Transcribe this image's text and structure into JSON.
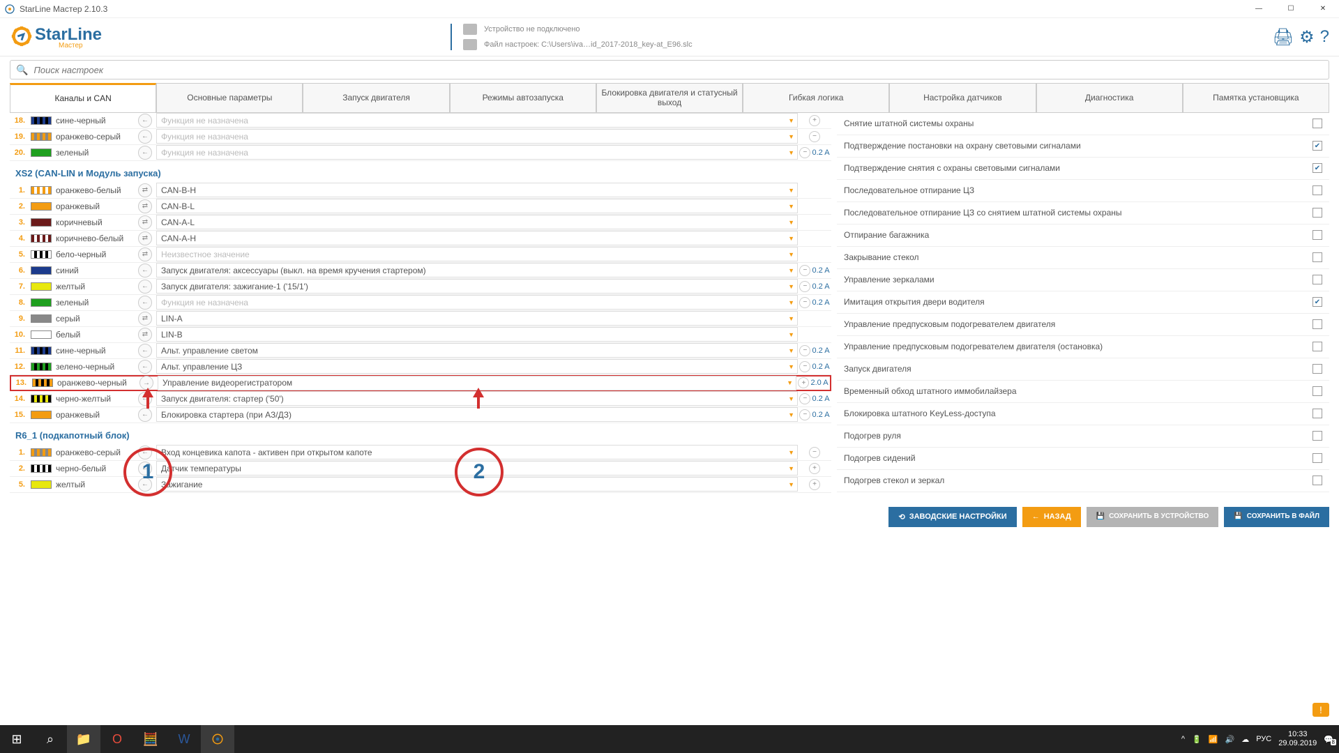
{
  "window": {
    "title": "StarLine Мастер 2.10.3"
  },
  "logo": {
    "brand": "StarLine",
    "sub": "Мастер"
  },
  "device": {
    "status": "Устройство не подключено",
    "file_label": "Файл настроек: C:\\Users\\iva…id_2017-2018_key-at_E96.slc"
  },
  "search": {
    "placeholder": "Поиск настроек"
  },
  "tabs": [
    "Каналы и CAN",
    "Основные параметры",
    "Запуск двигателя",
    "Режимы автозапуска",
    "Блокировка двигателя и статусный выход",
    "Гибкая логика",
    "Настройка датчиков",
    "Диагностика",
    "Памятка установщика"
  ],
  "tabs_active": 0,
  "channels_top": [
    {
      "n": "18.",
      "wire": "#1c3b8c/#000",
      "name": "сине-черный",
      "pol": "←",
      "func": "Функция не назначена",
      "gray": true,
      "amp": "",
      "pm": "+"
    },
    {
      "n": "19.",
      "wire": "#f39c12/#888",
      "name": "оранжево-серый",
      "pol": "←",
      "func": "Функция не назначена",
      "gray": true,
      "amp": "",
      "pm": "−"
    },
    {
      "n": "20.",
      "wire": "#1fa01f",
      "name": "зеленый",
      "pol": "←",
      "func": "Функция не назначена",
      "gray": true,
      "amp": "0.2 A",
      "pm": "−"
    }
  ],
  "section_xs2": "XS2 (CAN-LIN и Модуль запуска)",
  "channels_xs2": [
    {
      "n": "1.",
      "wire": "#f39c12/#fff",
      "name": "оранжево-белый",
      "pol": "⇄",
      "func": "CAN-B-H",
      "amp": ""
    },
    {
      "n": "2.",
      "wire": "#f39c12",
      "name": "оранжевый",
      "pol": "⇄",
      "func": "CAN-B-L",
      "amp": ""
    },
    {
      "n": "3.",
      "wire": "#6b1a1a",
      "name": "коричневый",
      "pol": "⇄",
      "func": "CAN-A-L",
      "amp": ""
    },
    {
      "n": "4.",
      "wire": "#6b1a1a/#fff",
      "name": "коричнево-белый",
      "pol": "⇄",
      "func": "CAN-A-H",
      "amp": ""
    },
    {
      "n": "5.",
      "wire": "#fff/#000",
      "name": "бело-черный",
      "pol": "⇄",
      "func": "Неизвестное значение",
      "gray": true,
      "amp": ""
    },
    {
      "n": "6.",
      "wire": "#1c3b8c",
      "name": "синий",
      "pol": "←",
      "func": "Запуск двигателя: аксессуары (выкл. на время кручения стартером)",
      "amp": "0.2 A",
      "pm": "−"
    },
    {
      "n": "7.",
      "wire": "#e8e80e",
      "name": "желтый",
      "pol": "←",
      "func": "Запуск двигателя: зажигание-1 ('15/1')",
      "amp": "0.2 A",
      "pm": "−"
    },
    {
      "n": "8.",
      "wire": "#1fa01f",
      "name": "зеленый",
      "pol": "←",
      "func": "Функция не назначена",
      "gray": true,
      "amp": "0.2 A",
      "pm": "−"
    },
    {
      "n": "9.",
      "wire": "#888",
      "name": "серый",
      "pol": "⇄",
      "func": "LIN-A",
      "amp": ""
    },
    {
      "n": "10.",
      "wire": "#fff",
      "name": "белый",
      "pol": "⇄",
      "func": "LIN-B",
      "amp": ""
    },
    {
      "n": "11.",
      "wire": "#1c3b8c/#000",
      "name": "сине-черный",
      "pol": "←",
      "func": "Альт. управление светом",
      "amp": "0.2 A",
      "pm": "−"
    },
    {
      "n": "12.",
      "wire": "#1fa01f/#000",
      "name": "зелено-черный",
      "pol": "←",
      "func": "Альт. управление ЦЗ",
      "amp": "0.2 A",
      "pm": "−"
    },
    {
      "n": "13.",
      "wire": "#f39c12/#000",
      "name": "оранжево-черный",
      "pol": "→",
      "func": "Управление видеорегистратором",
      "amp": "2.0 A",
      "pm": "+",
      "hl": true
    },
    {
      "n": "14.",
      "wire": "#000/#e8e80e",
      "name": "черно-желтый",
      "pol": "←",
      "func": "Запуск двигателя: стартер ('50')",
      "amp": "0.2 A",
      "pm": "−"
    },
    {
      "n": "15.",
      "wire": "#f39c12",
      "name": "оранжевый",
      "pol": "←",
      "func": "Блокировка стартера (при АЗ/ДЗ)",
      "amp": "0.2 A",
      "pm": "−"
    }
  ],
  "section_r6": "R6_1 (подкапотный блок)",
  "channels_r6": [
    {
      "n": "1.",
      "wire": "#f39c12/#888",
      "name": "оранжево-серый",
      "pol": "←",
      "func": "Вход концевика капота - активен при открытом капоте",
      "amp": "",
      "pm": "−"
    },
    {
      "n": "2.",
      "wire": "#000/#fff",
      "name": "черно-белый",
      "pol": "←",
      "func": "Датчик температуры",
      "amp": "",
      "pm": "+"
    },
    {
      "n": "5.",
      "wire": "#e8e80e",
      "name": "желтый",
      "pol": "←",
      "func": "Зажигание",
      "amp": "",
      "pm": "+"
    }
  ],
  "options": [
    {
      "label": "Снятие штатной системы охраны",
      "chk": false
    },
    {
      "label": "Подтверждение постановки на охрану световыми сигналами",
      "chk": true
    },
    {
      "label": "Подтверждение снятия с охраны световыми сигналами",
      "chk": true
    },
    {
      "label": "Последовательное отпирание ЦЗ",
      "chk": false
    },
    {
      "label": "Последовательное отпирание ЦЗ со снятием штатной системы охраны",
      "chk": false
    },
    {
      "label": "Отпирание багажника",
      "chk": false
    },
    {
      "label": "Закрывание стекол",
      "chk": false
    },
    {
      "label": "Управление зеркалами",
      "chk": false
    },
    {
      "label": "Имитация открытия двери водителя",
      "chk": true
    },
    {
      "label": "Управление предпусковым подогревателем двигателя",
      "chk": false
    },
    {
      "label": "Управление предпусковым подогревателем двигателя (остановка)",
      "chk": false
    },
    {
      "label": "Запуск двигателя",
      "chk": false
    },
    {
      "label": "Временный обход штатного иммобилайзера",
      "chk": false
    },
    {
      "label": "Блокировка штатного KeyLess-доступа",
      "chk": false
    },
    {
      "label": "Подогрев руля",
      "chk": false
    },
    {
      "label": "Подогрев сидений",
      "chk": false
    },
    {
      "label": "Подогрев стекол и зеркал",
      "chk": false
    }
  ],
  "buttons": {
    "factory": "ЗАВОДСКИЕ НАСТРОЙКИ",
    "back": "НАЗАД",
    "save_dev": "СОХРАНИТЬ В УСТРОЙСТВО",
    "save_file": "СОХРАНИТЬ В ФАЙЛ"
  },
  "taskbar": {
    "lang": "РУС",
    "time": "10:33",
    "date": "29.09.2019",
    "notif": "8"
  },
  "annot": {
    "n1": "1",
    "n2": "2"
  }
}
